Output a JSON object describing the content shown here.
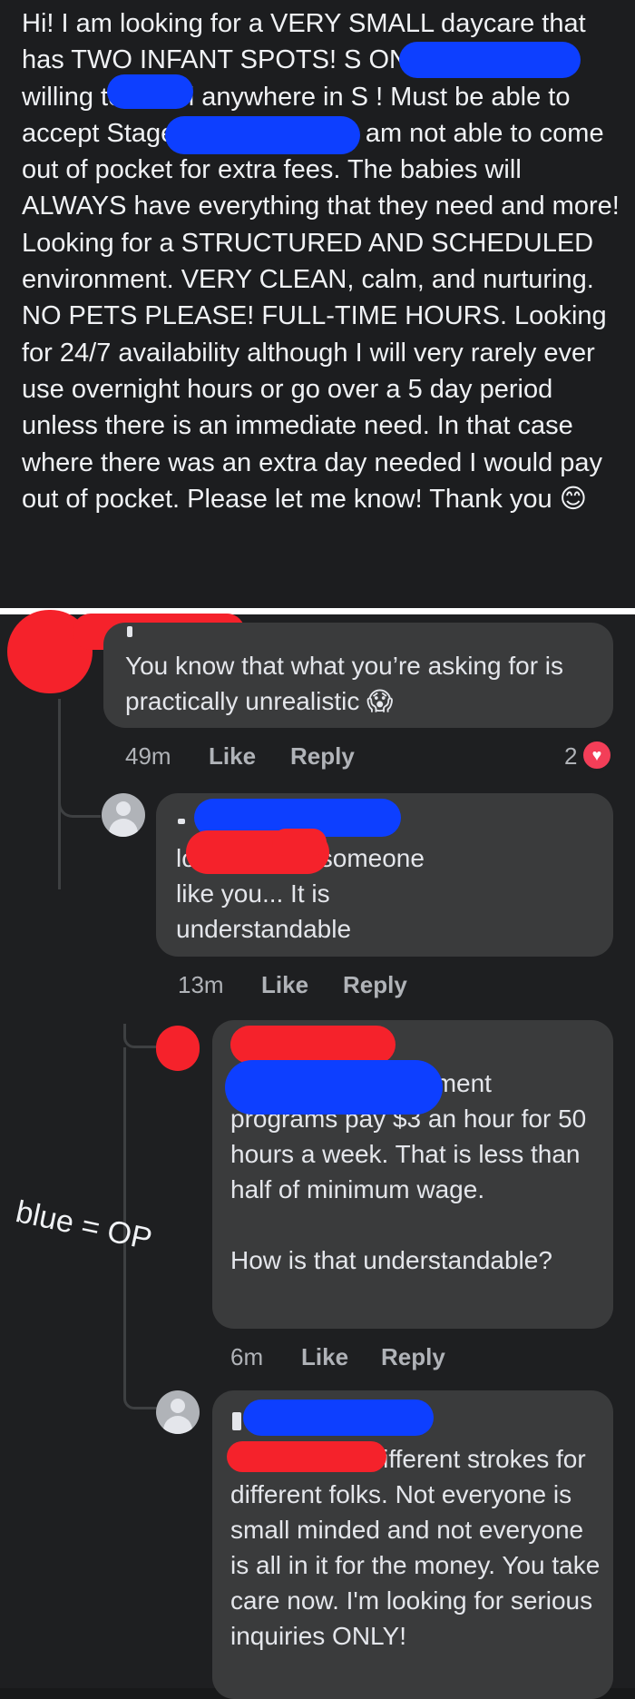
{
  "post": {
    "text": "Hi! I am looking for a VERY SMALL daycare that has TWO INFANT SPOTS! S ONLY! S area but willing to travel anywhere in S ! Must be able to accept Stage I/Child Action. I am not able to come out of pocket for extra fees. The babies will ALWAYS have everything that they need and more! Looking for a STRUCTURED AND SCHEDULED environment. VERY CLEAN, calm, and nurturing. NO PETS PLEASE! FULL-TIME HOURS. Looking for 24/7 availability although I will very rarely ever use overnight hours or go over a 5 day period unless there is an immediate need. In that case where there was an extra day needed I would pay out of pocket. Please let me know! Thank you 😊"
  },
  "comments": [
    {
      "text": "You know that what you’re asking for is practically unrealistic 😱",
      "time": "49m",
      "like_label": "Like",
      "reply_label": "Reply",
      "reaction_count": "2",
      "reaction_icon": "heart-icon"
    },
    {
      "text": "lol maybe to someone like you... It is understandable",
      "time": "13m",
      "like_label": "Like",
      "reply_label": "Reply"
    },
    {
      "text": "subsidized government programs pay $3 an hour for 50 hours a week. That is less than half of minimum wage.\n\nHow is that understandable?",
      "time": "6m",
      "like_label": "Like",
      "reply_label": "Reply"
    },
    {
      "text": "I have seen different strokes for different folks. Not everyone is small minded and not everyone is all in it for the money. You take care now. I'm looking for serious inquiries ONLY!"
    }
  ],
  "annotation": "blue = OP",
  "colors": {
    "redaction_red": "#f5222b",
    "redaction_blue": "#0d3fff",
    "bubble": "#3a3b3c",
    "background": "#18191a"
  }
}
